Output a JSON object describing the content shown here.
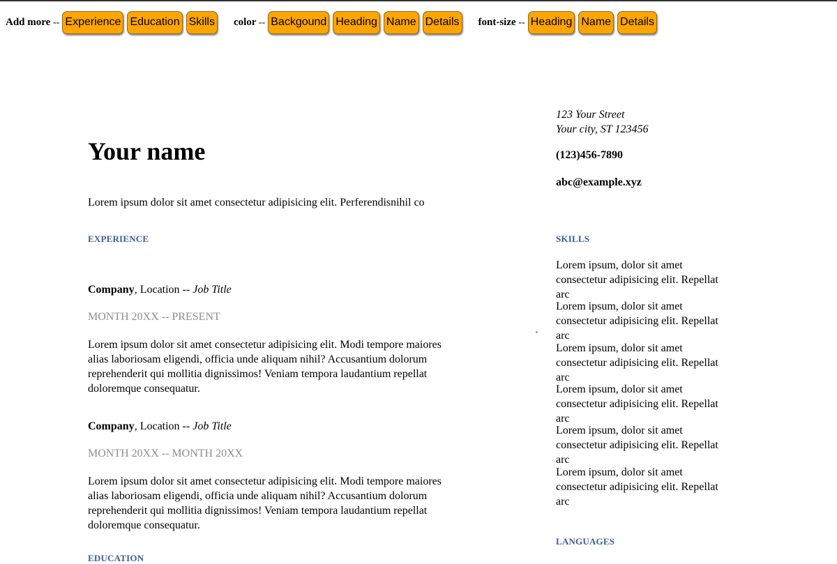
{
  "toolbar": {
    "add_more_label": "Add more",
    "color_label": "color",
    "font_size_label": "font-size",
    "separator": "--",
    "add_more_buttons": [
      "Experience",
      "Education",
      "Skills"
    ],
    "color_buttons": [
      "Backgound",
      "Heading",
      "Name",
      "Details"
    ],
    "font_size_buttons": [
      "Heading",
      "Name",
      "Details"
    ]
  },
  "resume": {
    "name": "Your name",
    "intro": "Lorem ipsum dolor sit amet consectetur adipisicing elit. Perferendisnihil co",
    "address_line1": "123 Your Street",
    "address_line2": "Your city, ST 123456",
    "phone": "(123)456-7890",
    "email": "abc@example.xyz",
    "sections": {
      "experience": "EXPERIENCE",
      "skills": "SKILLS",
      "languages": "LANGUAGES",
      "education": "EDUCATION"
    },
    "jobs": [
      {
        "company": "Company",
        "location": ", Location -- ",
        "title": "Job Title",
        "dates": "MONTH 20XX -- PRESENT",
        "description": "Lorem ipsum dolor sit amet consectetur adipisicing elit. Modi tempore maiores alias laboriosam eligendi, officia unde aliquam nihil? Accusantium dolorum reprehenderit qui mollitia dignissimos! Veniam tempora laudantium repellat doloremque consequatur."
      },
      {
        "company": "Company",
        "location": ", Location -- ",
        "title": "Job Title",
        "dates": "MONTH 20XX -- MONTH 20XX",
        "description": "Lorem ipsum dolor sit amet consectetur adipisicing elit. Modi tempore maiores alias laboriosam eligendi, officia unde aliquam nihil? Accusantium dolorum reprehenderit qui mollitia dignissimos! Veniam tempora laudantium repellat doloremque consequatur."
      }
    ],
    "skills": [
      "Lorem ipsum, dolor sit amet consectetur adipisicing elit. Repellat arc",
      "Lorem ipsum, dolor sit amet consectetur adipisicing elit. Repellat arc",
      "Lorem ipsum, dolor sit amet consectetur adipisicing elit. Repellat arc",
      "Lorem ipsum, dolor sit amet consectetur adipisicing elit. Repellat arc",
      "Lorem ipsum, dolor sit amet consectetur adipisicing elit. Repellat arc",
      "Lorem ipsum, dolor sit amet consectetur adipisicing elit. Repellat arc"
    ]
  },
  "colors": {
    "button_bg": "#ffa500",
    "section_heading": "#3a5f8f",
    "date_text": "#8e8e8e"
  }
}
